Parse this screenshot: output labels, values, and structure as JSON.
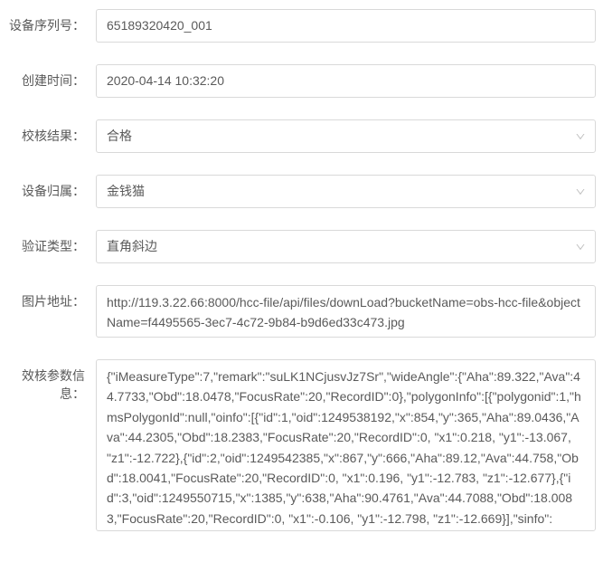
{
  "fields": {
    "device_serial": {
      "label": "设备序列号：",
      "value": "65189320420_001"
    },
    "create_time": {
      "label": "创建时间：",
      "value": "2020-04-14 10:32:20"
    },
    "check_result": {
      "label": "校核结果：",
      "value": "合格"
    },
    "device_owner": {
      "label": "设备归属：",
      "value": "金钱猫"
    },
    "verify_type": {
      "label": "验证类型：",
      "value": "直角斜边"
    },
    "image_url": {
      "label": "图片地址：",
      "value": "http://119.3.22.66:8000/hcc-file/api/files/downLoad?bucketName=obs-hcc-file&objectName=f4495565-3ec7-4c72-9b84-b9d6ed33c473.jpg"
    },
    "params_info": {
      "label": "效核参数信息：",
      "value": "{\"iMeasureType\":7,\"remark\":\"suLK1NCjusvJz7Sr\",\"wideAngle\":{\"Aha\":89.322,\"Ava\":44.7733,\"Obd\":18.0478,\"FocusRate\":20,\"RecordID\":0},\"polygonInfo\":[{\"polygonid\":1,\"hmsPolygonId\":null,\"oinfo\":[{\"id\":1,\"oid\":1249538192,\"x\":854,\"y\":365,\"Aha\":89.0436,\"Ava\":44.2305,\"Obd\":18.2383,\"FocusRate\":20,\"RecordID\":0, \"x1\":0.218, \"y1\":-13.067, \"z1\":-12.722},{\"id\":2,\"oid\":1249542385,\"x\":867,\"y\":666,\"Aha\":89.12,\"Ava\":44.758,\"Obd\":18.0041,\"FocusRate\":20,\"RecordID\":0, \"x1\":0.196, \"y1\":-12.783, \"z1\":-12.677},{\"id\":3,\"oid\":1249550715,\"x\":1385,\"y\":638,\"Aha\":90.4761,\"Ava\":44.7088,\"Obd\":18.0083,\"FocusRate\":20,\"RecordID\":0, \"x1\":-0.106, \"y1\":-12.798, \"z1\":-12.669}],\"sinfo\":"
    }
  }
}
